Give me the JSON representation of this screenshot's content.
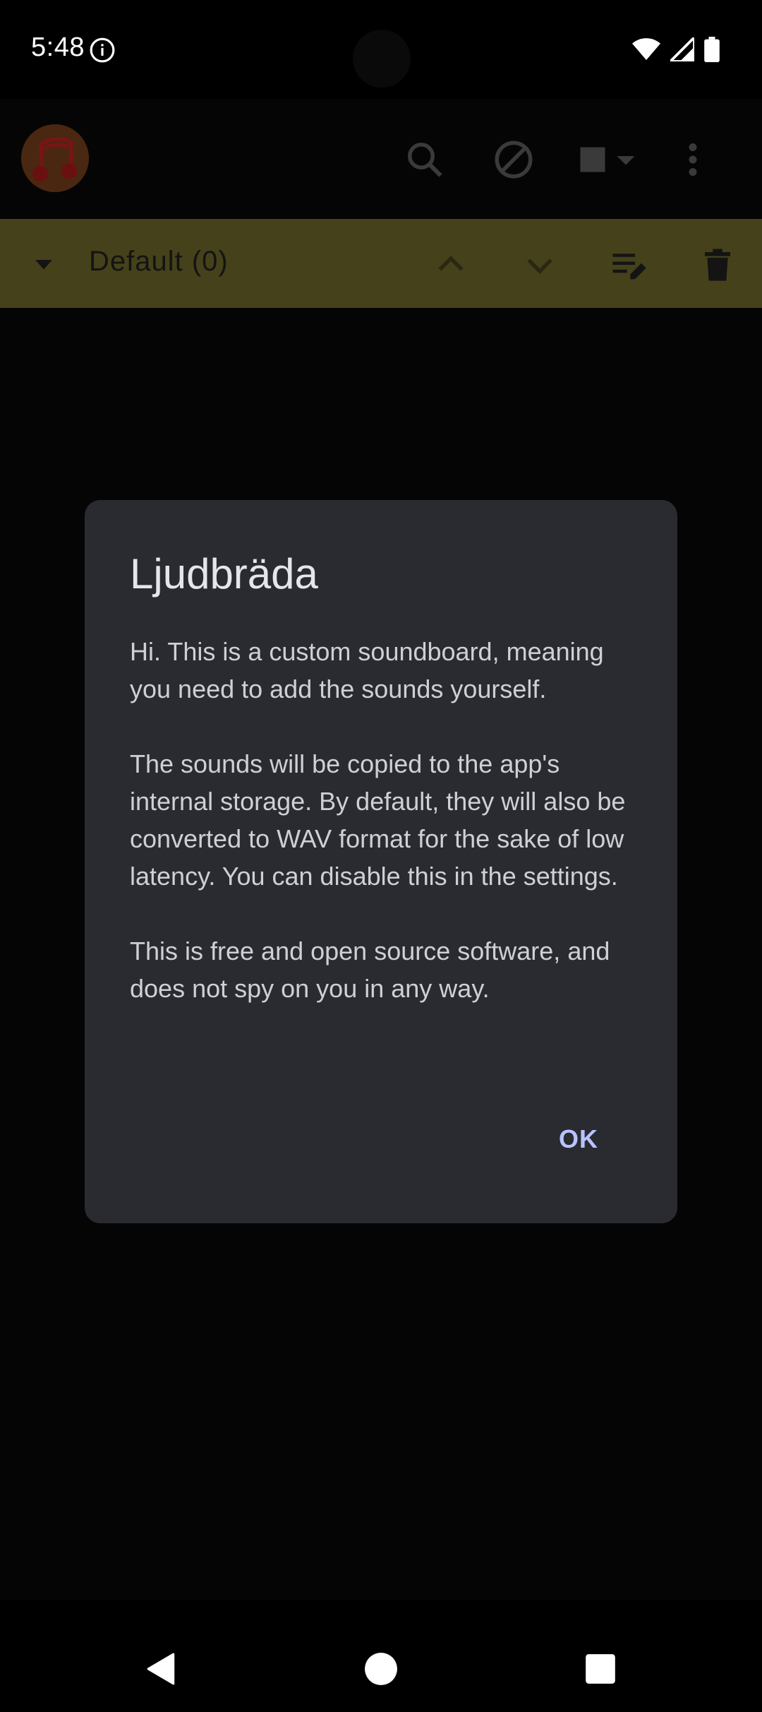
{
  "status_bar": {
    "time": "5:48",
    "icons": [
      "info-icon",
      "wifi-icon",
      "cellular-signal-icon",
      "battery-icon"
    ]
  },
  "toolbar": {
    "icons": [
      "app-logo",
      "search-icon",
      "block-icon",
      "stop-icon",
      "dropdown-caret-icon",
      "overflow-menu-icon"
    ]
  },
  "category": {
    "title": "Default (0)",
    "icons": [
      "collapse-caret-icon",
      "move-up-icon",
      "move-down-icon",
      "edit-list-icon",
      "delete-icon"
    ]
  },
  "dialog": {
    "title": "Ljudbräda",
    "paragraphs": [
      "Hi. This is a custom soundboard, meaning you need to add the sounds yourself.",
      "The sounds will be copied to the app's internal storage. By default, they will also be converted to WAV format for the sake of low latency. You can disable this in the settings.",
      "This is free and open source software, and does not spy on you in any way."
    ],
    "ok_label": "OK"
  },
  "navigation": {
    "icons": [
      "back-icon",
      "home-icon",
      "recents-icon"
    ]
  },
  "colors": {
    "dialog_background": "#2a2b30",
    "category_bar": "#45411a",
    "accent": "#b9c3ff"
  }
}
